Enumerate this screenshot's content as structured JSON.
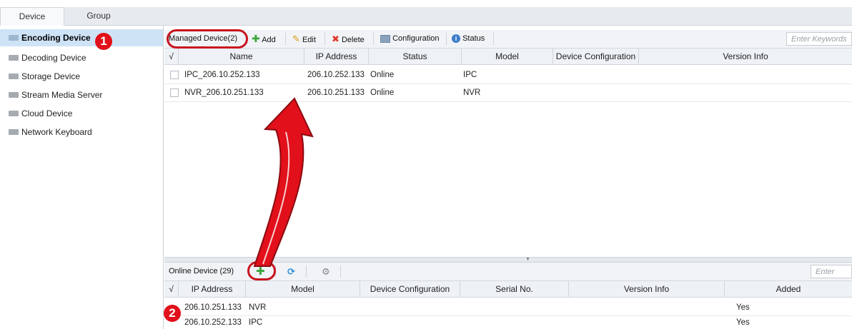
{
  "tabs": [
    "Device",
    "Group"
  ],
  "sidebar": {
    "items": [
      {
        "label": "Encoding Device",
        "icon": "encoding-device-icon",
        "active": true
      },
      {
        "label": "Decoding Device",
        "icon": "decoding-device-icon"
      },
      {
        "label": "Storage Device",
        "icon": "storage-device-icon"
      },
      {
        "label": "Stream Media Server",
        "icon": "server-icon"
      },
      {
        "label": "Cloud Device",
        "icon": "cloud-device-icon"
      },
      {
        "label": "Network Keyboard",
        "icon": "keyboard-icon"
      }
    ]
  },
  "managed": {
    "title": "Managed Device(2)",
    "add": "Add",
    "edit": "Edit",
    "delete": "Delete",
    "configuration": "Configuration",
    "status": "Status",
    "search_placeholder": "Enter Keywords",
    "columns": [
      "√",
      "Name",
      "IP Address",
      "Status",
      "Model",
      "Device Configuration",
      "Version Info"
    ],
    "rows": [
      {
        "name": "IPC_206.10.252.133",
        "ip": "206.10.252.133",
        "status": "Online",
        "model": "IPC"
      },
      {
        "name": "NVR_206.10.251.133",
        "ip": "206.10.251.133",
        "status": "Online",
        "model": "NVR"
      }
    ]
  },
  "online": {
    "title": "Online Device (29)",
    "search_placeholder": "Enter Keyw",
    "columns": [
      "√",
      "IP Address",
      "Model",
      "Device Configuration",
      "Serial No.",
      "Version Info",
      "Added"
    ],
    "rows": [
      {
        "ip": "206.10.251.133",
        "model": "NVR",
        "added": "Yes"
      },
      {
        "ip": "206.10.252.133",
        "model": "IPC",
        "added": "Yes"
      }
    ]
  },
  "annotations": {
    "step1": "1",
    "step2": "2"
  },
  "colors": {
    "accent_red": "#e1101a",
    "selection": "#cfe3f7",
    "add_green": "#3aa53a"
  }
}
